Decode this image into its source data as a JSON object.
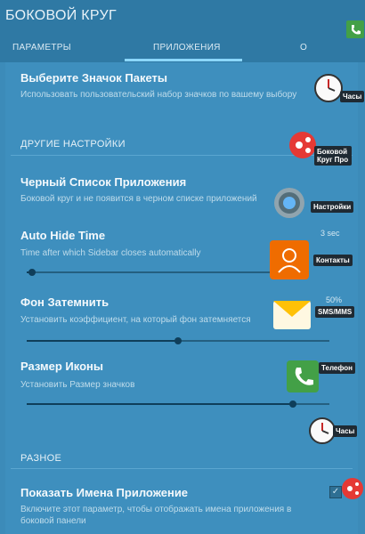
{
  "appbar": {
    "title": "БОКОВОЙ КРУГ"
  },
  "tabs": [
    {
      "label": "ПАРАМЕТРЫ"
    },
    {
      "label": "ПРИЛОЖЕНИЯ"
    },
    {
      "label": "О"
    }
  ],
  "settings": {
    "icon_pack": {
      "title": "Выберите Значок Пакеты",
      "subtitle": "Использовать пользовательский набор значков по вашему выбору"
    },
    "other_section": "ДРУГИЕ НАСТРОЙКИ",
    "blacklist": {
      "title": "Черный Список Приложения",
      "subtitle": "Боковой круг и не появится в черном списке приложений"
    },
    "auto_hide": {
      "title": "Auto Hide Time",
      "subtitle": "Time after which Sidebar closes automatically",
      "value": "3 sec",
      "slider": 0.02
    },
    "dim": {
      "title": "Фон Затемнить",
      "subtitle": "Установить коэффициент, на который фон затемняется",
      "value": "50%",
      "slider": 0.5
    },
    "icon_size": {
      "title": "Размер Иконы",
      "subtitle": "Установить Размер значков",
      "slider": 0.88
    },
    "misc_section": "РАЗНОЕ",
    "show_names": {
      "title": "Показать Имена Приложение",
      "subtitle": "Включите этот параметр, чтобы отображать имена приложения в боковой панели",
      "checked": true
    }
  },
  "floating": {
    "clock1": {
      "label": "Часы",
      "icon": "clock-icon"
    },
    "brand": {
      "label": "Боковой Круг Про",
      "icon": "sidebar-app-icon"
    },
    "settings": {
      "label": "Настройки",
      "icon": "gear-icon"
    },
    "contacts": {
      "label": "Контакты",
      "icon": "contacts-icon"
    },
    "sms": {
      "label": "SMS/MMS",
      "icon": "envelope-icon"
    },
    "phone": {
      "label": "Телефон",
      "icon": "phone-icon"
    },
    "clock2": {
      "label": "Часы",
      "icon": "clock-icon"
    }
  },
  "colors": {
    "accent": "#8bd7ff",
    "bar": "#2f79a4",
    "background": "#3e8fbe"
  }
}
